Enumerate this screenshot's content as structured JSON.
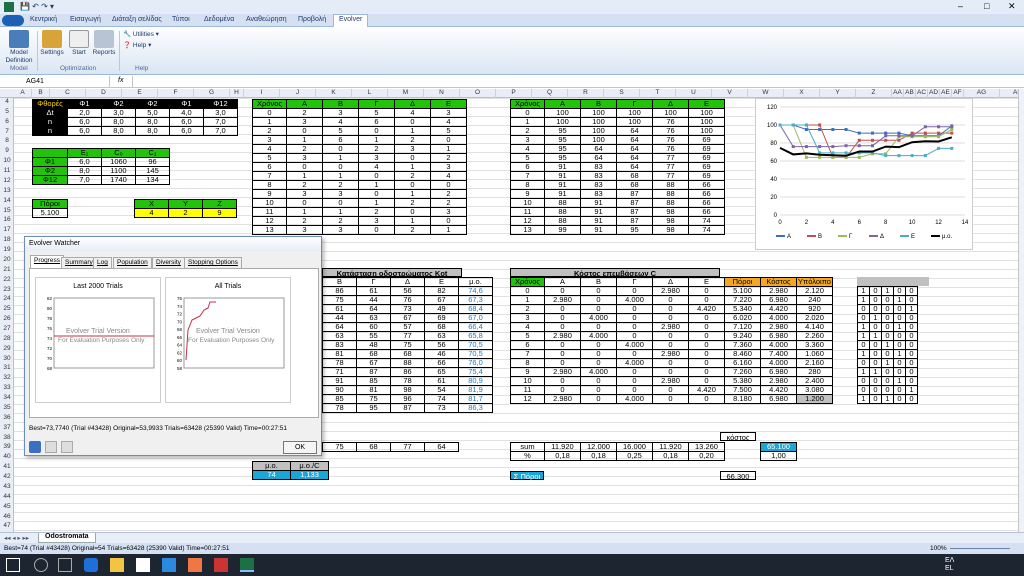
{
  "title_bar": {
    "window_buttons": [
      "–",
      "□",
      "✕"
    ]
  },
  "ribbon_tabs": [
    "Κεντρική",
    "Εισαγωγή",
    "Διάταξη σελίδας",
    "Τύποι",
    "Δεδομένα",
    "Αναθεώρηση",
    "Προβολή",
    "Evolver"
  ],
  "ribbon": {
    "model_definition": "Model Definition",
    "settings": "Settings",
    "start": "Start",
    "reports": "Reports",
    "utilities": "Utilities",
    "help": "Help",
    "group_model": "Model",
    "group_optimization": "Optimization",
    "group_help": "Help"
  },
  "formula_bar": {
    "name_box": "AG41",
    "fx": "fx",
    "formula": ""
  },
  "columns": [
    "A",
    "B",
    "C",
    "D",
    "E",
    "F",
    "G",
    "H",
    "I",
    "J",
    "K",
    "L",
    "M",
    "N",
    "O",
    "P",
    "Q",
    "R",
    "S",
    "T",
    "U",
    "V",
    "W",
    "X",
    "Y",
    "Z",
    "AA",
    "AB",
    "AC",
    "AD",
    "AE",
    "AF",
    "AG",
    "AH"
  ],
  "rows": [
    "4",
    "5",
    "6",
    "7",
    "8",
    "9",
    "10",
    "11",
    "12",
    "13",
    "14",
    "15",
    "16",
    "17",
    "18",
    "19",
    "20",
    "21",
    "22",
    "23",
    "24",
    "25",
    "26",
    "27",
    "28",
    "29",
    "30",
    "31",
    "32",
    "33",
    "34",
    "35",
    "36",
    "37",
    "38",
    "39",
    "40",
    "41",
    "42",
    "43",
    "44",
    "45",
    "46",
    "47"
  ],
  "table_phi": {
    "header": [
      "Φθορές",
      "Φ1",
      "Φ2",
      "Φ2",
      "Φ1",
      "Φ12"
    ],
    "rows": [
      [
        "Δt",
        "2,0",
        "3,0",
        "5,0",
        "4,0",
        "3,0"
      ],
      [
        "n",
        "6,0",
        "8,0",
        "8,0",
        "6,0",
        "7,0"
      ],
      [
        "n",
        "6,0",
        "8,0",
        "8,0",
        "6,0",
        "7,0"
      ]
    ]
  },
  "table_e": {
    "header": [
      "",
      "E₁",
      "C₀",
      "C₁"
    ],
    "rows": [
      [
        "Φ1",
        "6,0",
        "1060",
        "96"
      ],
      [
        "Φ2",
        "8,0",
        "1100",
        "145"
      ],
      [
        "Φ12",
        "7,0",
        "1740",
        "134"
      ]
    ]
  },
  "poroi": {
    "label": "Πόροι",
    "value": "5.100"
  },
  "xyz": {
    "header": [
      "X",
      "Y",
      "Z"
    ],
    "values": [
      "4",
      "2",
      "9"
    ]
  },
  "table_a": {
    "header": [
      "Χρόνος",
      "A",
      "B",
      "Γ",
      "Δ",
      "E"
    ],
    "rows": [
      [
        "0",
        "2",
        "3",
        "5",
        "4",
        "3"
      ],
      [
        "1",
        "3",
        "4",
        "6",
        "0",
        "4"
      ],
      [
        "2",
        "0",
        "5",
        "0",
        "1",
        "5"
      ],
      [
        "3",
        "1",
        "6",
        "1",
        "2",
        "0"
      ],
      [
        "4",
        "2",
        "0",
        "2",
        "3",
        "1"
      ],
      [
        "5",
        "3",
        "1",
        "3",
        "0",
        "2"
      ],
      [
        "6",
        "0",
        "0",
        "4",
        "1",
        "3"
      ],
      [
        "7",
        "1",
        "1",
        "0",
        "2",
        "4"
      ],
      [
        "8",
        "2",
        "2",
        "1",
        "0",
        "0"
      ],
      [
        "9",
        "3",
        "3",
        "0",
        "1",
        "2"
      ],
      [
        "10",
        "0",
        "0",
        "1",
        "2",
        "2"
      ],
      [
        "11",
        "1",
        "1",
        "2",
        "0",
        "3"
      ],
      [
        "12",
        "2",
        "2",
        "3",
        "1",
        "0"
      ],
      [
        "13",
        "3",
        "3",
        "0",
        "2",
        "1"
      ]
    ]
  },
  "table_b": {
    "header": [
      "Χρόνος",
      "A",
      "B",
      "Γ",
      "Δ",
      "E"
    ],
    "rows": [
      [
        "0",
        "100",
        "100",
        "100",
        "100",
        "100"
      ],
      [
        "1",
        "100",
        "100",
        "100",
        "76",
        "100"
      ],
      [
        "2",
        "95",
        "100",
        "64",
        "76",
        "100"
      ],
      [
        "3",
        "95",
        "100",
        "64",
        "76",
        "69"
      ],
      [
        "4",
        "95",
        "64",
        "64",
        "76",
        "69"
      ],
      [
        "5",
        "95",
        "64",
        "64",
        "77",
        "69"
      ],
      [
        "6",
        "91",
        "83",
        "64",
        "77",
        "69"
      ],
      [
        "7",
        "91",
        "83",
        "68",
        "77",
        "69"
      ],
      [
        "8",
        "91",
        "83",
        "68",
        "88",
        "66"
      ],
      [
        "9",
        "91",
        "83",
        "87",
        "88",
        "66"
      ],
      [
        "10",
        "88",
        "91",
        "87",
        "88",
        "66"
      ],
      [
        "11",
        "88",
        "91",
        "87",
        "98",
        "66"
      ],
      [
        "12",
        "88",
        "91",
        "87",
        "98",
        "74"
      ],
      [
        "13",
        "99",
        "91",
        "95",
        "98",
        "74"
      ]
    ]
  },
  "table_kat": {
    "title": "Κατάσταση οδοστρώματος Κot",
    "header": [
      "B",
      "Γ",
      "Δ",
      "E",
      "μ.ο."
    ],
    "rows": [
      [
        "86",
        "61",
        "56",
        "82",
        "74,6"
      ],
      [
        "75",
        "44",
        "76",
        "67",
        "67,3"
      ],
      [
        "61",
        "64",
        "73",
        "49",
        "68,4"
      ],
      [
        "44",
        "63",
        "67",
        "69",
        "67,0"
      ],
      [
        "64",
        "60",
        "57",
        "68",
        "66,4"
      ],
      [
        "63",
        "55",
        "77",
        "63",
        "65,8"
      ],
      [
        "83",
        "48",
        "75",
        "56",
        "70,5"
      ],
      [
        "81",
        "68",
        "68",
        "46",
        "70,5"
      ],
      [
        "78",
        "67",
        "88",
        "66",
        "76,0"
      ],
      [
        "71",
        "87",
        "86",
        "65",
        "75,4"
      ],
      [
        "91",
        "85",
        "78",
        "61",
        "80,9"
      ],
      [
        "90",
        "81",
        "98",
        "54",
        "81,9"
      ],
      [
        "85",
        "75",
        "96",
        "74",
        "81,7"
      ],
      [
        "78",
        "95",
        "87",
        "73",
        "86,3"
      ]
    ],
    "extra": [
      "75",
      "68",
      "77",
      "64"
    ]
  },
  "table_cost": {
    "title": "Κόστος επεμβάσεων C",
    "header": [
      "Χρόνος",
      "A",
      "B",
      "Γ",
      "Δ",
      "E",
      "Πόροι",
      "Κόστος",
      "Υπόλοιπο"
    ],
    "rows": [
      [
        "0",
        "0",
        "0",
        "0",
        "2.980",
        "0",
        "5.100",
        "2.980",
        "2.120"
      ],
      [
        "1",
        "2.980",
        "0",
        "4.000",
        "0",
        "0",
        "7.220",
        "6.980",
        "240"
      ],
      [
        "2",
        "0",
        "0",
        "0",
        "0",
        "4.420",
        "5.340",
        "4.420",
        "920"
      ],
      [
        "3",
        "0",
        "4.000",
        "0",
        "0",
        "0",
        "6.020",
        "4.000",
        "2.020"
      ],
      [
        "4",
        "0",
        "0",
        "0",
        "2.980",
        "0",
        "7.120",
        "2.980",
        "4.140"
      ],
      [
        "5",
        "2.980",
        "4.000",
        "0",
        "0",
        "0",
        "9.240",
        "6.980",
        "2.260"
      ],
      [
        "6",
        "0",
        "0",
        "4.000",
        "0",
        "0",
        "7.360",
        "4.000",
        "3.360"
      ],
      [
        "7",
        "0",
        "0",
        "0",
        "2.980",
        "0",
        "8.460",
        "7.400",
        "1.060"
      ],
      [
        "8",
        "0",
        "0",
        "4.000",
        "0",
        "0",
        "6.160",
        "4.000",
        "2.160"
      ],
      [
        "9",
        "2.980",
        "4.000",
        "0",
        "0",
        "0",
        "7.260",
        "6.980",
        "280"
      ],
      [
        "10",
        "0",
        "0",
        "0",
        "2.980",
        "0",
        "5.380",
        "2.980",
        "2.400"
      ],
      [
        "11",
        "0",
        "0",
        "0",
        "0",
        "4.420",
        "7.500",
        "4.420",
        "3.080"
      ],
      [
        "12",
        "2.980",
        "0",
        "4.000",
        "0",
        "0",
        "8.180",
        "6.980",
        "1.200"
      ]
    ]
  },
  "sum_row": {
    "label": "sum",
    "values": [
      "11.920",
      "12.000",
      "16.000",
      "11.920",
      "13.260"
    ],
    "total": "65.100",
    "kostos": "κόστος"
  },
  "pct_row": {
    "label": "%",
    "values": [
      "0,18",
      "0,18",
      "0,25",
      "0,18",
      "0,20"
    ],
    "total": "1,00"
  },
  "sigma_poroi": {
    "label": "Σ Πόροι",
    "value": "66.300"
  },
  "mo_table": {
    "header": [
      "μ.ο.",
      "μ.ο./C"
    ],
    "values": [
      "74",
      "1,133"
    ]
  },
  "binary_grid": [
    [
      "1",
      "0",
      "1",
      "0",
      "0"
    ],
    [
      "1",
      "0",
      "0",
      "1",
      "0"
    ],
    [
      "0",
      "0",
      "0",
      "0",
      "1"
    ],
    [
      "0",
      "1",
      "0",
      "0",
      "0"
    ],
    [
      "1",
      "0",
      "0",
      "1",
      "0"
    ],
    [
      "1",
      "1",
      "0",
      "0",
      "0"
    ],
    [
      "0",
      "0",
      "1",
      "0",
      "0"
    ],
    [
      "1",
      "0",
      "0",
      "1",
      "0"
    ],
    [
      "0",
      "0",
      "1",
      "0",
      "0"
    ],
    [
      "1",
      "1",
      "0",
      "0",
      "0"
    ],
    [
      "0",
      "0",
      "0",
      "1",
      "0"
    ],
    [
      "0",
      "0",
      "0",
      "0",
      "1"
    ],
    [
      "1",
      "0",
      "1",
      "0",
      "0"
    ]
  ],
  "watcher": {
    "title": "Evolver Watcher",
    "tabs": [
      "Progress",
      "Summary",
      "Log",
      "Population",
      "Diversity",
      "Stopping Options"
    ],
    "panel1_title": "Last 2000 Trials",
    "panel2_title": "All Trials",
    "watermark1": "Evolver Trial Version",
    "watermark2": "For Evaluation Purposes Only",
    "status": "Best=73,7740 (Trial #43428) Original=53,9933 Trials=63428 (25390 Valid) Time=00:27:51",
    "ok": "OK",
    "p1_y": [
      "82",
      "80",
      "78",
      "76",
      "74",
      "72",
      "70",
      "68"
    ],
    "p2_y": [
      "76",
      "74",
      "72",
      "70",
      "68",
      "66",
      "64",
      "62",
      "60",
      "58"
    ]
  },
  "sheet_tab": "Odostromata",
  "status_bar": {
    "text": "Best=74 (Trial #43428) Original=54 Trials=63428 (25390 Valid) Time=00:27:51",
    "zoom": "100%"
  },
  "taskbar": {
    "lang": "ΕΛ",
    "lang2": "EL"
  },
  "chart_data": {
    "type": "line",
    "x": [
      0,
      1,
      2,
      3,
      4,
      5,
      6,
      7,
      8,
      9,
      10,
      11,
      12,
      13
    ],
    "series": [
      {
        "name": "A",
        "color": "#3b6fc2",
        "values": [
          100,
          100,
          95,
          95,
          95,
          95,
          91,
          91,
          91,
          91,
          88,
          88,
          88,
          99
        ]
      },
      {
        "name": "B",
        "color": "#c0504d",
        "values": [
          100,
          100,
          100,
          100,
          64,
          64,
          83,
          83,
          83,
          83,
          91,
          91,
          91,
          91
        ]
      },
      {
        "name": "Γ",
        "color": "#9bbb59",
        "values": [
          100,
          100,
          64,
          64,
          64,
          64,
          64,
          68,
          68,
          87,
          87,
          87,
          87,
          95
        ]
      },
      {
        "name": "Δ",
        "color": "#8064a2",
        "values": [
          100,
          76,
          76,
          76,
          76,
          77,
          77,
          77,
          88,
          88,
          88,
          98,
          98,
          98
        ]
      },
      {
        "name": "E",
        "color": "#4bacc6",
        "values": [
          100,
          100,
          100,
          69,
          69,
          69,
          69,
          69,
          66,
          66,
          66,
          66,
          74,
          74
        ]
      },
      {
        "name": "μ.ο.",
        "color": "#000000",
        "values": [
          74.6,
          67.3,
          68.4,
          67.0,
          66.4,
          65.8,
          70.5,
          70.5,
          76.0,
          75.4,
          80.9,
          81.9,
          81.7,
          86.3
        ]
      }
    ],
    "ylim": [
      0,
      120
    ],
    "xlim": [
      0,
      14
    ],
    "yticks": [
      "0",
      "20",
      "40",
      "60",
      "80",
      "100",
      "120"
    ],
    "xticks": [
      "0",
      "2",
      "4",
      "6",
      "8",
      "10",
      "12",
      "14"
    ],
    "legend": "bottom"
  }
}
